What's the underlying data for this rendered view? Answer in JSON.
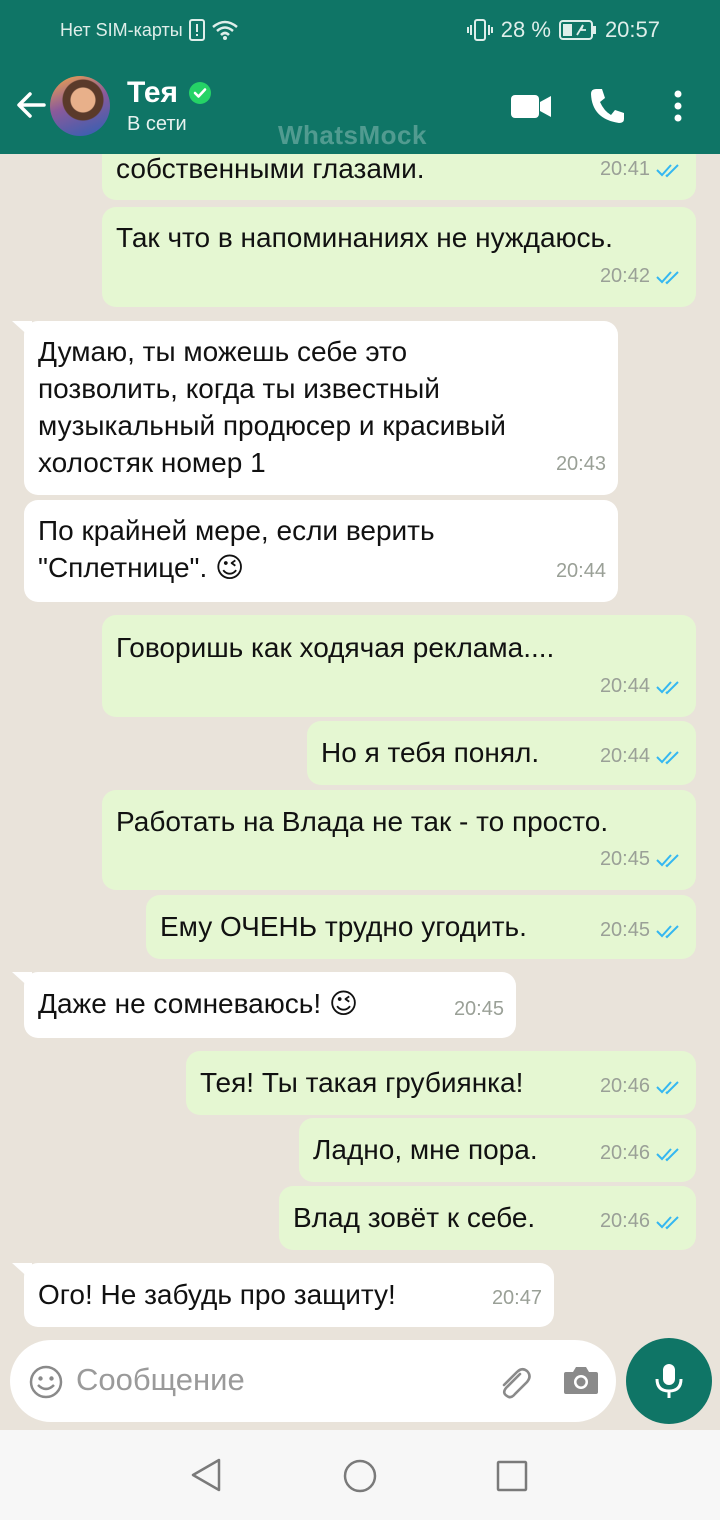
{
  "status_bar": {
    "sim": "Нет SIM-карты",
    "battery": "28 %",
    "time": "20:57"
  },
  "header": {
    "contact_name": "Тея",
    "status": "В сети",
    "watermark": "WhatsMock"
  },
  "messages": [
    {
      "dir": "out",
      "text": "собственными глазами.",
      "time": "20:41"
    },
    {
      "dir": "out",
      "text": "Так что в напоминаниях не нуждаюсь.",
      "time": "20:42"
    },
    {
      "dir": "in",
      "lines": [
        "Думаю, ты можешь себе это",
        "позволить, когда ты известный",
        "музыкальный продюсер и красивый",
        "холостяк номер 1"
      ],
      "time": "20:43"
    },
    {
      "dir": "in",
      "lines": [
        "По крайней мере, если верить",
        "\"Сплетнице\". 😉"
      ],
      "time": "20:44"
    },
    {
      "dir": "out",
      "text": "Говоришь как ходячая реклама....",
      "time": "20:44"
    },
    {
      "dir": "out",
      "text": "Но я тебя понял.",
      "time": "20:44"
    },
    {
      "dir": "out",
      "text": "Работать на Влада не так - то просто.",
      "time": "20:45"
    },
    {
      "dir": "out",
      "text": "Ему ОЧЕНЬ трудно угодить.",
      "time": "20:45"
    },
    {
      "dir": "in",
      "text": "Даже не сомневаюсь! 😉",
      "time": "20:45"
    },
    {
      "dir": "out",
      "text": "Тея! Ты такая грубиянка!",
      "time": "20:46"
    },
    {
      "dir": "out",
      "text": "Ладно, мне пора.",
      "time": "20:46"
    },
    {
      "dir": "out",
      "text": "Влад зовёт к себе.",
      "time": "20:46"
    },
    {
      "dir": "in",
      "text": "Ого! Не забудь про защиту!",
      "time": "20:47"
    }
  ],
  "input": {
    "placeholder": "Сообщение"
  },
  "icons": {
    "back": "arrow-left-icon",
    "video": "video-camera-icon",
    "call": "phone-icon",
    "more": "more-vertical-icon",
    "emoji": "emoji-icon",
    "attach": "paperclip-icon",
    "camera": "camera-icon",
    "mic": "microphone-icon",
    "verified": "verified-badge-icon"
  },
  "colors": {
    "header": "#0f7566",
    "outgoing_bubble": "#e5f7d2",
    "incoming_bubble": "#ffffff",
    "read_tick": "#34b7f1",
    "background": "#e9e3da"
  }
}
